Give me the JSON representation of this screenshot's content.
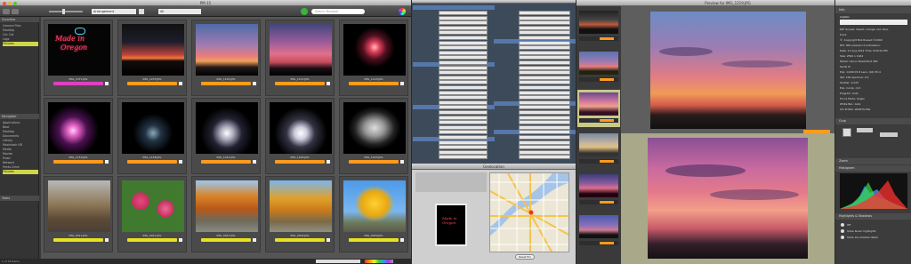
{
  "browser": {
    "title": "PM 15",
    "mode": "Arrangement",
    "filter": "All",
    "search_placeholder": "Search Browser",
    "favorites_header": "Favorites",
    "favorites": [
      "Camera Files",
      "Desktop",
      "Our Cat",
      "Logs",
      "Pictures"
    ],
    "favorites_selected": 4,
    "navigator_header": "Navigator",
    "navigator": [
      "Applications",
      "Boot",
      "Desktop",
      "Documents",
      "Library",
      "Macintosh HD",
      "Media",
      "Movies",
      "Music",
      "Network",
      "Peeks Drive",
      "Pictures"
    ],
    "navigator_selected": 11,
    "tasks_header": "Tasks",
    "status": "1 of 16 items",
    "thumbs": [
      {
        "name": "IMG_1071.JPG",
        "bar": "#e040c0",
        "kind": "neon"
      },
      {
        "name": "IMG_1233.JPG",
        "bar": "#ff9a1e",
        "kind": "sunset1"
      },
      {
        "name": "IMG_1181.JPG",
        "bar": "#ff9a1e",
        "kind": "sunset2"
      },
      {
        "name": "IMG_1121.JPG",
        "bar": "#ff9a1e",
        "kind": "sunset3"
      },
      {
        "name": "IMG_1143.JPG",
        "bar": "#ff9a1e",
        "kind": "fireworks"
      },
      {
        "name": "IMG_1153.JPG",
        "bar": "#ff9a1e",
        "kind": "fireworks2"
      },
      {
        "name": "IMG_1148.JPG",
        "bar": "#ff9a1e",
        "kind": "beams"
      },
      {
        "name": "IMG_1241.JPG",
        "bar": "#ff9a1e",
        "kind": "fountain"
      },
      {
        "name": "IMG_1246.JPG",
        "bar": "#ff9a1e",
        "kind": "fountain2"
      },
      {
        "name": "IMG_1003.JPG",
        "bar": "#ff9a1e",
        "kind": "sculpture"
      },
      {
        "name": "IMG_0411.JPG",
        "bar": "#e8e020",
        "kind": "statues"
      },
      {
        "name": "IMG_0441.JPG",
        "bar": "#e8e020",
        "kind": "roses"
      },
      {
        "name": "IMG_0447.JPG",
        "bar": "#e8e020",
        "kind": "autumn"
      },
      {
        "name": "IMG_0402.JPG",
        "bar": "#e8e020",
        "kind": "autumn2"
      },
      {
        "name": "IMG_0459.JPG",
        "bar": "#e8e020",
        "kind": "tree"
      }
    ],
    "neon_lines": [
      "Made in",
      "Oregon"
    ]
  },
  "inspector": {
    "info_header": "Info",
    "caption_label": "Caption",
    "lines": [
      "KW: Sunset, desert, orange, red, blue,",
      "trace",
      "©: Copyright Bob Russell ©2009",
      "DPI: 300 pixels/inch  Actuations:",
      "Date: 13 Aug 2014  Time: 6:09:21 PM",
      "Size: 2592 x 1944",
      "Model: Canon PowerShot 400",
      "Serial #:",
      "Exp: 1/200 f/2.8  Lens: (44) 55.4",
      "ISO: 100  Aperture: 4.0",
      "Shutter: 1/125",
      "Exp. Comp.: 0.0",
      "Program: Auto",
      "Focus Mode: Single",
      "White Bal.: Auto",
      "ICC Profile: sRGB Profile"
    ],
    "crop_header": "Crop",
    "zoom_header": "Zoom",
    "histogram_header": "Histogram",
    "hs_header": "Highlights & Shadows",
    "hs_options": [
      "Off",
      "Show blown highlights",
      "Show low shadow detail"
    ]
  },
  "preview": {
    "title": "Preview for IMG_1219.JPG"
  },
  "metadata": {
    "title": "Metadata",
    "map_title": "Geolocation",
    "map_button": "Reset Pin"
  }
}
